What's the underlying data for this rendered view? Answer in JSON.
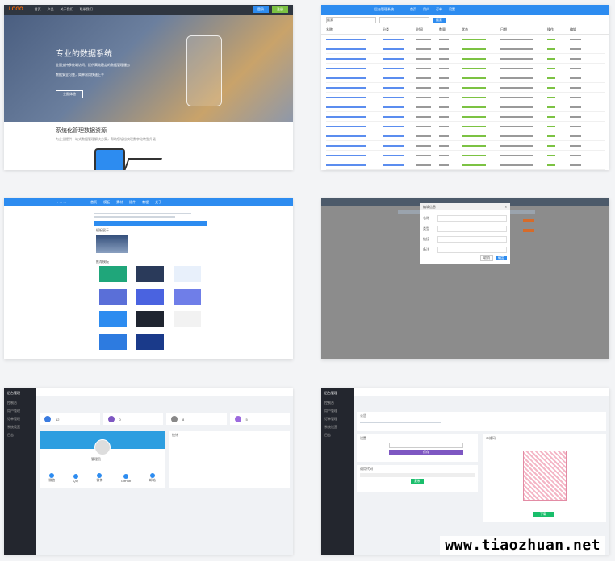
{
  "gallery": {
    "watermark": "www.tiaozhuan.net"
  },
  "panel1": {
    "nav": [
      "首页",
      "产品",
      "关于我们",
      "联系我们"
    ],
    "btn_login": "登录",
    "btn_register": "注册",
    "hero_title": "专业的数据系统",
    "hero_line1": "全面支持多终端访问，提供高效稳定的数据管理服务",
    "hero_line2": "数据安全可靠，简单易用快速上手",
    "hero_btn": "立即体验",
    "section_title": "系统化管理数据资源",
    "section_text": "为企业提供一站式数据管理解决方案，帮助您轻松实现数字化转型升级"
  },
  "panel2": {
    "title": "后台管理系统",
    "tabs": [
      "首页",
      "用户",
      "订单",
      "设置"
    ],
    "search_placeholder": "搜索",
    "search_btn": "搜索",
    "columns": [
      "名称",
      "分类",
      "时间",
      "数量",
      "状态",
      "日期",
      "操作",
      "编辑"
    ]
  },
  "panel3": {
    "nav": [
      "首页",
      "模板",
      "素材",
      "插件",
      "教程",
      "关于"
    ],
    "section1": "模板展示",
    "section2": "推荐模板"
  },
  "panel4": {
    "modal_title": "编辑信息",
    "labels": [
      "名称",
      "类型",
      "链接",
      "备注"
    ],
    "cancel": "取消",
    "ok": "确定"
  },
  "panel5": {
    "brand": "后台管理",
    "menu": [
      "控制台",
      "用户管理",
      "订单管理",
      "系统设置",
      "日志"
    ],
    "stats": [
      "12",
      "0",
      "8",
      "5"
    ],
    "profile_name": "管理员",
    "chart_label": "统计",
    "icons": [
      "微信",
      "QQ",
      "微博",
      "GitHub",
      "邮箱"
    ]
  },
  "panel6": {
    "brand": "后台管理",
    "menu": [
      "控制台",
      "用户管理",
      "订单管理",
      "系统设置",
      "日志"
    ],
    "notice_title": "公告",
    "form_title": "设置",
    "form_btn": "保存",
    "qr_title": "二维码",
    "qr_btn": "下载",
    "code_title": "调用代码",
    "code_btn": "复制"
  }
}
